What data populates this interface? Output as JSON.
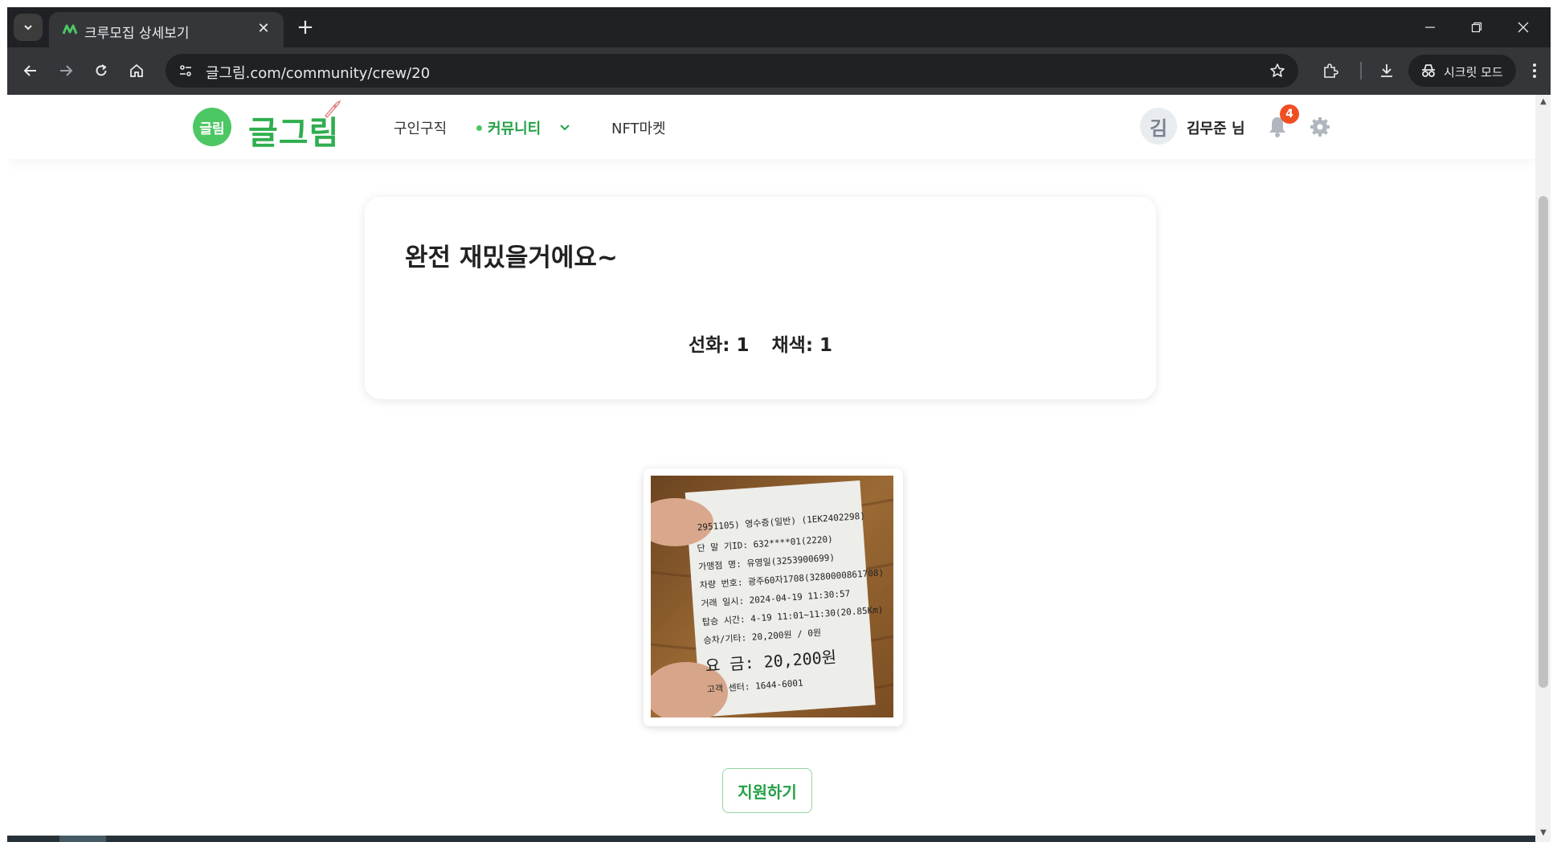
{
  "browser": {
    "tab_title": "크루모집 상세보기",
    "url": "글그림.com/community/crew/20",
    "incognito_label": "시크릿 모드"
  },
  "site": {
    "logo_mark": "글림",
    "logo_text": "글그림",
    "nav": {
      "jobs": "구인구직",
      "community": "커뮤니티",
      "nft_market": "NFT마켓"
    },
    "user": {
      "avatar_initial": "김",
      "name": "김무준 님",
      "notification_count": "4"
    }
  },
  "post": {
    "title": "완전 재밌을거에요~",
    "recruit": [
      {
        "label": "선화: 1"
      },
      {
        "label": "채색: 1"
      }
    ],
    "image_alt": "receipt photo",
    "receipt_text": {
      "header": "2951105)   영수증(일반)   (1EK2402298)",
      "lines": [
        "단 말 기ID: 632****01(2220)",
        "가맹점 명: 유영일(3253900699)",
        "차량 번호: 광주60자1708(3280000861708)",
        "거래 일시: 2024-04-19 11:30:57",
        "탑승 시간: 4-19 11:01~11:30(20.85Km)",
        "승차/기타: 20,200원 / 0원"
      ],
      "amount": "요   금: 20,200원",
      "footer": "고객 센터: 1644-6001"
    }
  },
  "actions": {
    "apply_label": "지원하기"
  },
  "colors": {
    "brand_green": "#4cc764",
    "accent_green": "#22a045",
    "badge_red": "#f04e23"
  }
}
